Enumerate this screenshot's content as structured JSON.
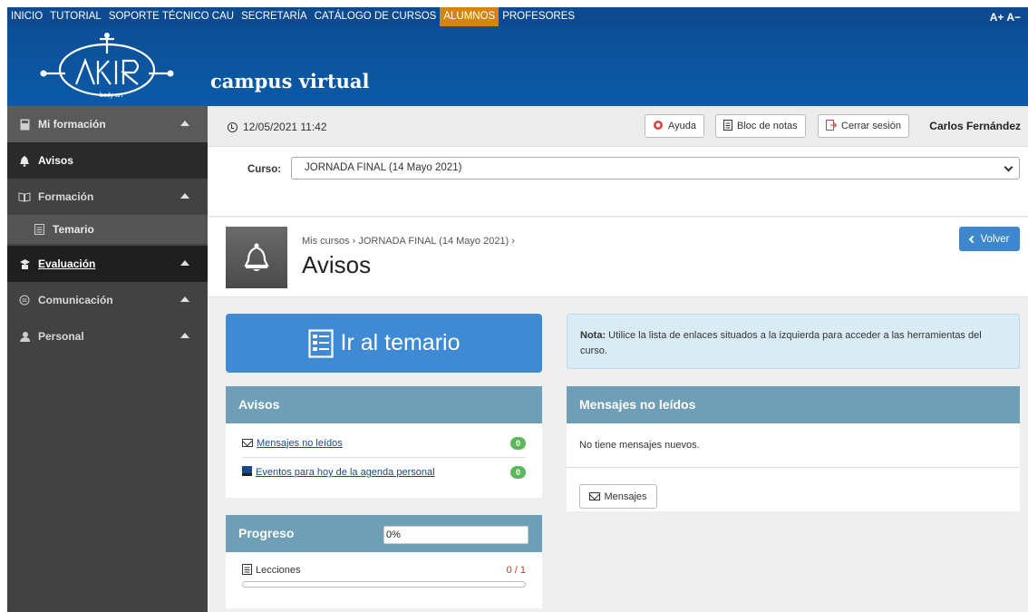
{
  "topnav": {
    "items": [
      "INICIO",
      "TUTORIAL",
      "SOPORTE TÉCNICO CAU",
      "SECRETARÍA",
      "CATÁLOGO DE CURSOS",
      "ALUMNOS",
      "PROFESORES"
    ],
    "active": "ALUMNOS",
    "font_controls": "A+ A−",
    "active_color": "#d4850f",
    "bg_color": "#0d4a8f"
  },
  "header": {
    "logo_text": "body art",
    "brand": "campus virtual"
  },
  "sidebar": {
    "items": [
      {
        "label": "Mi formación",
        "icon": "calculator-icon"
      },
      {
        "label": "Avisos",
        "icon": "bell-icon"
      },
      {
        "label": "Formación",
        "icon": "book-icon"
      },
      {
        "label": "Temario",
        "icon": "document-icon"
      },
      {
        "label": "Evaluación",
        "icon": "graduate-icon"
      },
      {
        "label": "Comunicación",
        "icon": "chat-icon"
      },
      {
        "label": "Personal",
        "icon": "user-icon"
      }
    ]
  },
  "statusbar": {
    "datetime": "12/05/2021 11:42",
    "help_label": "Ayuda",
    "notes_label": "Bloc de notas",
    "logout_label": "Cerrar sesión",
    "username": "Carlos Fernández"
  },
  "curso": {
    "label": "Curso:",
    "selected": "JORNADA FINAL (14 Mayo 2021)"
  },
  "title": {
    "breadcrumb": "Mis cursos › JORNADA FINAL (14 Mayo 2021) ›",
    "heading": "Avisos",
    "back_label": "Volver"
  },
  "temario_button": "Ir al temario",
  "nota": {
    "label": "Nota:",
    "text": " Utilice la lista de enlaces situados a la izquierda para acceder a las herramientas del curso."
  },
  "avisos_panel": {
    "title": "Avisos",
    "rows": [
      {
        "label": "Mensajes no leídos",
        "count": "0"
      },
      {
        "label": "Eventos para hoy de la agenda personal",
        "count": "0"
      }
    ]
  },
  "mensajes_panel": {
    "title": "Mensajes no leídos",
    "empty_text": "No tiene mensajes nuevos.",
    "button_label": "Mensajes"
  },
  "progreso_panel": {
    "title": "Progreso",
    "percent": "0%",
    "lecciones_label": "Lecciones",
    "lecciones_count": "0 / 1",
    "lecciones_progress": 0
  }
}
